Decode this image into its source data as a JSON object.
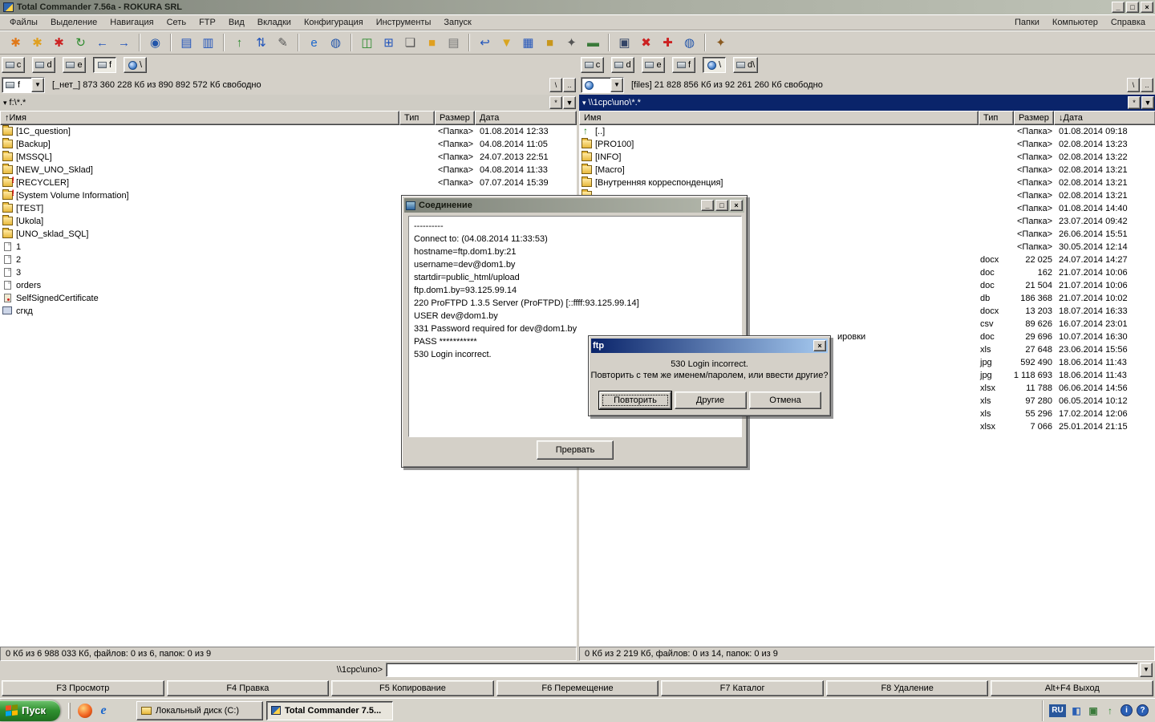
{
  "window": {
    "title": "Total Commander 7.56a - ROKURA SRL",
    "menu": [
      "Файлы",
      "Выделение",
      "Навигация",
      "Сеть",
      "FTP",
      "Вид",
      "Вкладки",
      "Конфигурация",
      "Инструменты",
      "Запуск"
    ],
    "menu_right": [
      "Папки",
      "Компьютер",
      "Справка"
    ]
  },
  "icons": {
    "minimize": "_",
    "maximize": "□",
    "close": "×",
    "dropdown": "▼",
    "small_arrow": "▾"
  },
  "panel_buttons": {
    "root": "\\",
    "parent": "..",
    "star": "*"
  },
  "toolbar": {
    "icons": [
      {
        "name": "reread-source-icon",
        "glyph": "✱",
        "color": "#e07818"
      },
      {
        "name": "reread-target-icon",
        "glyph": "✱",
        "color": "#e0a020"
      },
      {
        "name": "reread-all-icon",
        "glyph": "✱",
        "color": "#cc2222"
      },
      {
        "name": "swap-panels-icon",
        "glyph": "↻",
        "color": "#2e8b2e"
      },
      {
        "name": "history-back-icon",
        "glyph": "←",
        "color": "#2255bb"
      },
      {
        "name": "history-forward-icon",
        "glyph": "→",
        "color": "#2255bb"
      },
      {
        "sep": true
      },
      {
        "name": "search-icon",
        "glyph": "◉",
        "color": "#2255aa"
      },
      {
        "sep": true
      },
      {
        "name": "tree-left-icon",
        "glyph": "▤",
        "color": "#2255bb"
      },
      {
        "name": "tree-right-icon",
        "glyph": "▥",
        "color": "#2255bb"
      },
      {
        "sep": true
      },
      {
        "name": "parent-dir-icon",
        "glyph": "↑",
        "color": "#2e8b2e"
      },
      {
        "name": "sort-icon",
        "glyph": "⇅",
        "color": "#2255bb"
      },
      {
        "name": "edit-icon",
        "glyph": "✎",
        "color": "#555555"
      },
      {
        "sep": true
      },
      {
        "name": "browser-icon",
        "glyph": "e",
        "color": "#1a66cc"
      },
      {
        "name": "network-globe-icon",
        "glyph": "◍",
        "color": "#2255aa"
      },
      {
        "sep": true
      },
      {
        "name": "horizontal-panels-icon",
        "glyph": "◫",
        "color": "#2e8b2e"
      },
      {
        "name": "vertical-panels-icon",
        "glyph": "⊞",
        "color": "#2255bb"
      },
      {
        "name": "new-window-icon",
        "glyph": "❏",
        "color": "#555555"
      },
      {
        "name": "folder-icon",
        "glyph": "■",
        "color": "#e0a020"
      },
      {
        "name": "notes-icon",
        "glyph": "▤",
        "color": "#777777"
      },
      {
        "sep": true
      },
      {
        "name": "undo-icon",
        "glyph": "↩",
        "color": "#2255bb"
      },
      {
        "name": "filter-icon",
        "glyph": "▼",
        "color": "#d9a520"
      },
      {
        "name": "grid-view-icon",
        "glyph": "▦",
        "color": "#2255bb"
      },
      {
        "name": "open-folder-icon",
        "glyph": "■",
        "color": "#c8971c"
      },
      {
        "name": "tools-icon",
        "glyph": "✦",
        "color": "#555555"
      },
      {
        "name": "archive-icon",
        "glyph": "▬",
        "color": "#3a7a3a"
      },
      {
        "sep": true
      },
      {
        "name": "remote-desktop-icon",
        "glyph": "▣",
        "color": "#334466"
      },
      {
        "name": "ftp-disconnect-icon",
        "glyph": "✖",
        "color": "#cc2222"
      },
      {
        "name": "ftp-new-connection-icon",
        "glyph": "✚",
        "color": "#cc2222"
      },
      {
        "name": "ftp-connect-icon",
        "glyph": "◍",
        "color": "#2255aa"
      },
      {
        "sep": true
      },
      {
        "name": "config-icon",
        "glyph": "✦",
        "color": "#8a5a20"
      }
    ]
  },
  "left_panel": {
    "drive_letter": "f",
    "drives": [
      {
        "label": "c",
        "icon": "hdd"
      },
      {
        "label": "d",
        "icon": "hdd"
      },
      {
        "label": "e",
        "icon": "hdd"
      },
      {
        "label": "f",
        "icon": "hdd",
        "pressed": true
      },
      {
        "label": "\\",
        "icon": "globe"
      }
    ],
    "drive_info": "[_нет_] 873 360 228 Кб из 890 892 572 Кб свободно",
    "path": "f:\\*.*",
    "columns": [
      "↑Имя",
      "Тип",
      "Размер",
      "Дата"
    ],
    "rows": [
      {
        "name": "[1C_question]",
        "icon": "folder",
        "size": "<Папка>",
        "date": "01.08.2014 12:33"
      },
      {
        "name": "[Backup]",
        "icon": "folder",
        "size": "<Папка>",
        "date": "04.08.2014 11:05"
      },
      {
        "name": "[MSSQL]",
        "icon": "folder",
        "size": "<Папка>",
        "date": "24.07.2013 22:51"
      },
      {
        "name": "[NEW_UNO_Sklad]",
        "icon": "folder",
        "size": "<Папка>",
        "date": "04.08.2014 11:33"
      },
      {
        "name": "[RECYCLER]",
        "icon": "folder-warn",
        "size": "<Папка>",
        "date": "07.07.2014 15:39"
      },
      {
        "name": "[System Volume Information]",
        "icon": "folder-warn",
        "size": "",
        "date": ""
      },
      {
        "name": "[TEST]",
        "icon": "folder",
        "size": "",
        "date": ""
      },
      {
        "name": "[Ukola]",
        "icon": "folder",
        "size": "",
        "date": ""
      },
      {
        "name": "[UNO_sklad_SQL]",
        "icon": "folder",
        "size": "",
        "date": ""
      },
      {
        "name": "1",
        "icon": "file",
        "size": "",
        "date": ""
      },
      {
        "name": "2",
        "icon": "file",
        "size": "",
        "date": ""
      },
      {
        "name": "3",
        "icon": "file",
        "size": "",
        "date": ""
      },
      {
        "name": "orders",
        "icon": "file",
        "size": "",
        "date": ""
      },
      {
        "name": "SelfSignedCertificate",
        "icon": "cert",
        "size": "",
        "date": ""
      },
      {
        "name": "сгкд",
        "icon": "app",
        "size": "",
        "date": ""
      }
    ],
    "status": "0 Кб из 6 988 033 Кб, файлов: 0 из 6, папок: 0 из 9"
  },
  "right_panel": {
    "drives": [
      {
        "label": "c",
        "icon": "hdd"
      },
      {
        "label": "d",
        "icon": "hdd"
      },
      {
        "label": "e",
        "icon": "hdd"
      },
      {
        "label": "f",
        "icon": "hdd"
      },
      {
        "label": "\\",
        "icon": "globe",
        "pressed": true
      },
      {
        "label": "d\\",
        "icon": "hdd"
      }
    ],
    "drive_info": "[files] 21 828 856 Кб из 92 261 260 Кб свободно",
    "path": "\\\\1cpc\\uno\\*.*",
    "columns": [
      "Имя",
      "Тип",
      "Размер",
      "↓Дата"
    ],
    "rows": [
      {
        "name": "[..]",
        "icon": "up",
        "size": "<Папка>",
        "date": "01.08.2014 09:18"
      },
      {
        "name": "[PRO100]",
        "icon": "folder",
        "size": "<Папка>",
        "date": "02.08.2014 13:23"
      },
      {
        "name": "[INFO]",
        "icon": "folder",
        "size": "<Папка>",
        "date": "02.08.2014 13:22"
      },
      {
        "name": "[Macro]",
        "icon": "folder",
        "size": "<Папка>",
        "date": "02.08.2014 13:21"
      },
      {
        "name": "[Внутренняя корреспонденция]",
        "icon": "folder",
        "size": "<Папка>",
        "date": "02.08.2014 13:21"
      },
      {
        "name": "",
        "icon": "folder",
        "size": "<Папка>",
        "date": "02.08.2014 13:21"
      },
      {
        "name": "",
        "icon": "folder",
        "size": "<Папка>",
        "date": "01.08.2014 14:40"
      },
      {
        "name": "",
        "icon": "folder",
        "size": "<Папка>",
        "date": "23.07.2014 09:42"
      },
      {
        "name": "",
        "icon": "folder",
        "size": "<Папка>",
        "date": "26.06.2014 15:51"
      },
      {
        "name": "",
        "icon": "folder",
        "size": "<Папка>",
        "date": "30.05.2014 12:14"
      },
      {
        "name": "",
        "icon": "file",
        "type": "docx",
        "size": "22 025",
        "date": "24.07.2014 14:27"
      },
      {
        "name": "",
        "icon": "file",
        "type": "doc",
        "size": "162",
        "date": "21.07.2014 10:06"
      },
      {
        "name": "",
        "icon": "file",
        "type": "doc",
        "size": "21 504",
        "date": "21.07.2014 10:06"
      },
      {
        "name": "",
        "icon": "file",
        "type": "db",
        "size": "186 368",
        "date": "21.07.2014 10:02"
      },
      {
        "name": "",
        "icon": "file",
        "type": "docx",
        "size": "13 203",
        "date": "18.07.2014 16:33"
      },
      {
        "name": "",
        "icon": "file",
        "type": "csv",
        "size": "89 626",
        "date": "16.07.2014 23:01"
      },
      {
        "name": "ировки",
        "name_indent": 302,
        "icon": "file",
        "type": "doc",
        "size": "29 696",
        "date": "10.07.2014 16:30"
      },
      {
        "name": "",
        "icon": "file",
        "type": "xls",
        "size": "27 648",
        "date": "23.06.2014 15:56"
      },
      {
        "name": "",
        "icon": "file",
        "type": "jpg",
        "size": "592 490",
        "date": "18.06.2014 11:43"
      },
      {
        "name": "",
        "icon": "file",
        "type": "jpg",
        "size": "1 118 693",
        "date": "18.06.2014 11:43"
      },
      {
        "name": "",
        "icon": "file",
        "type": "xlsx",
        "size": "11 788",
        "date": "06.06.2014 14:56"
      },
      {
        "name": "",
        "icon": "file",
        "type": "xls",
        "size": "97 280",
        "date": "06.05.2014 10:12"
      },
      {
        "name": "",
        "icon": "file",
        "type": "xls",
        "size": "55 296",
        "date": "17.02.2014 12:06"
      },
      {
        "name": "",
        "icon": "file",
        "type": "xlsx",
        "size": "7 066",
        "date": "25.01.2014 21:15"
      }
    ],
    "status": "0 Кб из 2 219 Кб, файлов: 0 из 14, папок: 0 из 9"
  },
  "dialogs": {
    "connection": {
      "title": "Соединение",
      "log": [
        "----------",
        "Connect to: (04.08.2014 11:33:53)",
        "hostname=ftp.dom1.by:21",
        "username=dev@dom1.by",
        "startdir=public_html/upload",
        "ftp.dom1.by=93.125.99.14",
        "220 ProFTPD 1.3.5 Server (ProFTPD) [::ffff:93.125.99.14]",
        "USER dev@dom1.by",
        "331 Password required for dev@dom1.by",
        "PASS ***********",
        "530 Login incorrect."
      ],
      "abort_label": "Прервать"
    },
    "ftp_prompt": {
      "title": "ftp",
      "line1": "530 Login incorrect.",
      "line2": "Повторить с тем же именем/паролем, или ввести другие?",
      "buttons": [
        "Повторить",
        "Другие",
        "Отмена"
      ]
    }
  },
  "command_line": {
    "prompt": "\\\\1cpc\\uno>",
    "value": ""
  },
  "function_keys": [
    "F3 Просмотр",
    "F4 Правка",
    "F5 Копирование",
    "F6 Перемещение",
    "F7 Каталог",
    "F8 Удаление",
    "Alt+F4 Выход"
  ],
  "taskbar": {
    "start_label": "Пуск",
    "quick_launch": [
      {
        "name": "firefox-icon",
        "glyph": ""
      },
      {
        "name": "ie-icon",
        "glyph": "e"
      }
    ],
    "tasks": [
      {
        "label": "Локальный диск (C:)",
        "icon": "folder",
        "active": false
      },
      {
        "label": "Total Commander 7.5...",
        "icon": "tc",
        "active": true
      }
    ],
    "tray": {
      "language": "RU",
      "icons": [
        {
          "name": "tc-tray-icon",
          "glyph": "◧",
          "color": "#2a5fb4"
        },
        {
          "name": "display-tray-icon",
          "glyph": "▣",
          "color": "#3a7a3a"
        },
        {
          "name": "updates-tray-icon",
          "glyph": "↑",
          "color": "#2e8b2e"
        },
        {
          "name": "info-tray-icon",
          "glyph": "i",
          "round": true
        },
        {
          "name": "help-tray-icon",
          "glyph": "?",
          "round": true
        }
      ]
    }
  }
}
